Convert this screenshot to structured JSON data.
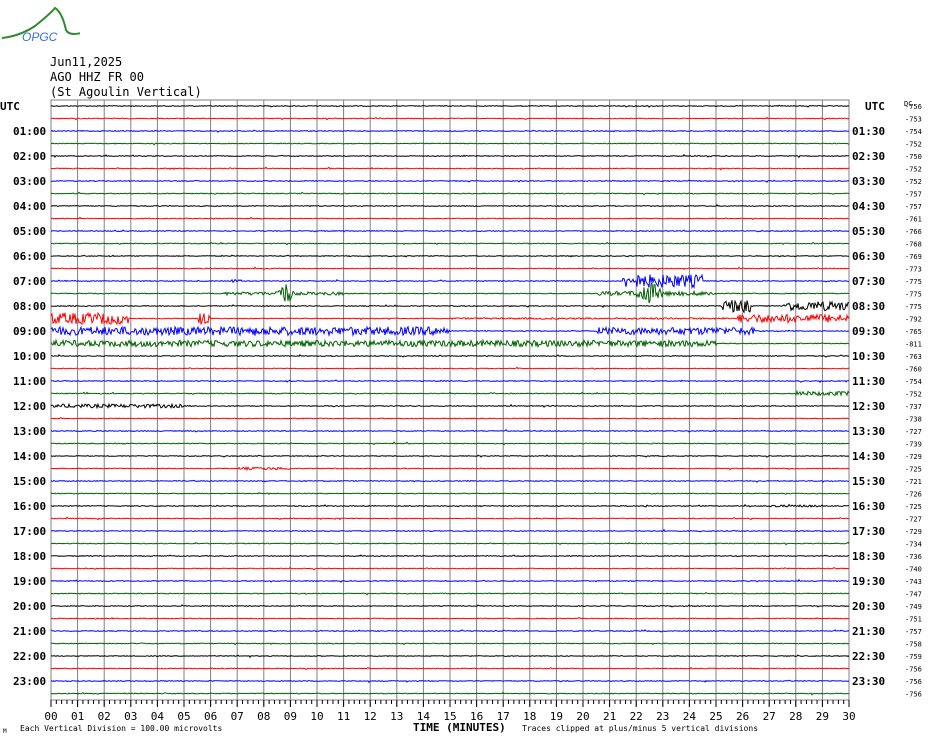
{
  "header": {
    "logo_text": "OPGC",
    "date": "Jun11,2025",
    "station": "AGO HHZ FR 00",
    "site": "(St Agoulin Vertical)",
    "left_utc": "UTC",
    "right_utc": "UTC",
    "offset_header": "DC"
  },
  "footer": {
    "scale_note": "Each Vertical Division =  100.00 microvolts",
    "axis_title": "TIME (MINUTES)",
    "clip_note": "Traces clipped at plus/minus 5 vertical divisions",
    "corner_mark": "M"
  },
  "colors": {
    "trace": [
      "#000000",
      "#ff0000",
      "#0000ff",
      "#006400"
    ],
    "grid": "#808080"
  },
  "chart_data": {
    "type": "line",
    "title": "AGO HHZ FR 00 (St Agoulin Vertical) Jun11,2025",
    "xlabel": "TIME (MINUTES)",
    "xlim": [
      0,
      30
    ],
    "x_ticks": [
      "00",
      "01",
      "02",
      "03",
      "04",
      "05",
      "06",
      "07",
      "08",
      "09",
      "10",
      "11",
      "12",
      "13",
      "14",
      "15",
      "16",
      "17",
      "18",
      "19",
      "20",
      "21",
      "22",
      "23",
      "24",
      "25",
      "26",
      "27",
      "28",
      "29",
      "30"
    ],
    "left_labels": [
      "UTC",
      "",
      "01:00",
      "",
      "02:00",
      "",
      "03:00",
      "",
      "04:00",
      "",
      "05:00",
      "",
      "06:00",
      "",
      "07:00",
      "",
      "08:00",
      "",
      "09:00",
      "",
      "10:00",
      "",
      "11:00",
      "",
      "12:00",
      "",
      "13:00",
      "",
      "14:00",
      "",
      "15:00",
      "",
      "16:00",
      "",
      "17:00",
      "",
      "18:00",
      "",
      "19:00",
      "",
      "20:00",
      "",
      "21:00",
      "",
      "22:00",
      "",
      "23:00",
      ""
    ],
    "right_labels": [
      "UTC",
      "",
      "01:30",
      "",
      "02:30",
      "",
      "03:30",
      "",
      "04:30",
      "",
      "05:30",
      "",
      "06:30",
      "",
      "07:30",
      "",
      "08:30",
      "",
      "09:30",
      "",
      "10:30",
      "",
      "11:30",
      "",
      "12:30",
      "",
      "13:30",
      "",
      "14:30",
      "",
      "15:30",
      "",
      "16:30",
      "",
      "17:30",
      "",
      "18:30",
      "",
      "19:30",
      "",
      "20:30",
      "",
      "21:30",
      "",
      "22:30",
      "",
      "23:30",
      ""
    ],
    "dc_offsets": [
      "-756",
      "-753",
      "-754",
      "-752",
      "-750",
      "-752",
      "-752",
      "-757",
      "-757",
      "-761",
      "-766",
      "-768",
      "-769",
      "-773",
      "-775",
      "-775",
      "-775",
      "-792",
      "-765",
      "-811",
      "-763",
      "-760",
      "-754",
      "-752",
      "-737",
      "-738",
      "-727",
      "-739",
      "-729",
      "-725",
      "-721",
      "-726",
      "-725",
      "-727",
      "-729",
      "-734",
      "-736",
      "-740",
      "-743",
      "-747",
      "-749",
      "-751",
      "-757",
      "-758",
      "-759",
      "-756",
      "-756",
      "-756"
    ],
    "traces": 48,
    "base_noise_divisions": 0.15,
    "events": [
      {
        "row": 14,
        "start": 21.5,
        "end": 24.5,
        "amplitude": 2.5
      },
      {
        "row": 14,
        "start": 6.8,
        "end": 7.2,
        "amplitude": 0.6
      },
      {
        "row": 15,
        "start": 6.5,
        "end": 11,
        "amplitude": 0.6
      },
      {
        "row": 15,
        "start": 8.4,
        "end": 9.2,
        "amplitude": 5
      },
      {
        "row": 15,
        "start": 20.5,
        "end": 25,
        "amplitude": 0.8
      },
      {
        "row": 15,
        "start": 21.8,
        "end": 23.2,
        "amplitude": 5
      },
      {
        "row": 16,
        "start": 25.2,
        "end": 26.3,
        "amplitude": 2.5
      },
      {
        "row": 16,
        "start": 27.5,
        "end": 30,
        "amplitude": 1.8
      },
      {
        "row": 17,
        "start": 0,
        "end": 2.9,
        "amplitude": 2.2
      },
      {
        "row": 17,
        "start": 5.5,
        "end": 6.0,
        "amplitude": 2.5
      },
      {
        "row": 17,
        "start": 15,
        "end": 25.6,
        "amplitude": 0.3
      },
      {
        "row": 17,
        "start": 25.8,
        "end": 30,
        "amplitude": 1.6
      },
      {
        "row": 18,
        "start": 0,
        "end": 15,
        "amplitude": 1.6
      },
      {
        "row": 18,
        "start": 20.5,
        "end": 26.5,
        "amplitude": 1.4
      },
      {
        "row": 19,
        "start": 0,
        "end": 25,
        "amplitude": 1.2
      },
      {
        "row": 23,
        "start": 28,
        "end": 30,
        "amplitude": 0.8
      },
      {
        "row": 24,
        "start": 0,
        "end": 5,
        "amplitude": 0.7
      },
      {
        "row": 29,
        "start": 7,
        "end": 9,
        "amplitude": 0.5
      },
      {
        "row": 32,
        "start": 27,
        "end": 29,
        "amplitude": 0.4
      }
    ]
  }
}
